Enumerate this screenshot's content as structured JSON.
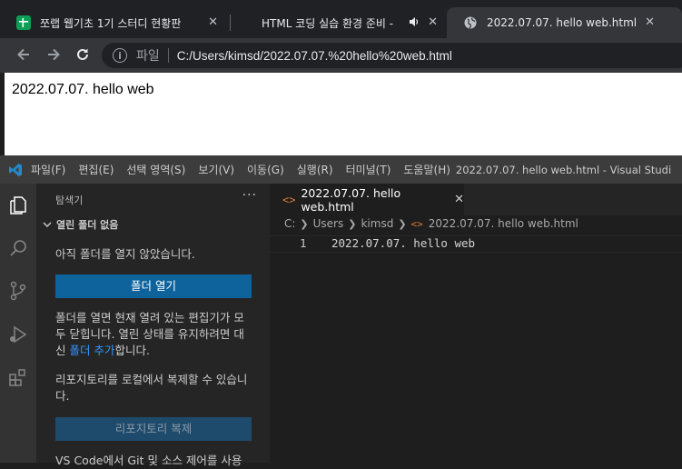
{
  "browser": {
    "tabs": [
      {
        "title": "쪼랩 웹기초 1기 스터디 현황판",
        "icon": "sheets-icon"
      },
      {
        "title": "HTML 코딩 실습 환경 준비 -",
        "icon": "speaker-icon"
      },
      {
        "title": "2022.07.07. hello web.html",
        "icon": "globe-icon"
      }
    ],
    "address": {
      "scheme_label": "파일",
      "url": "C:/Users/kimsd/2022.07.07.%20hello%20web.html"
    },
    "page_text": "2022.07.07. hello web"
  },
  "vscode": {
    "menu": [
      "파일(F)",
      "편집(E)",
      "선택 영역(S)",
      "보기(V)",
      "이동(G)",
      "실행(R)",
      "터미널(T)",
      "도움말(H)"
    ],
    "window_title": "2022.07.07. hello web.html - Visual Studi",
    "sidebar": {
      "header": "탐색기",
      "more": "···",
      "section": "열린 폴더 없음",
      "no_folder_msg": "아직 폴더를 열지 않았습니다.",
      "open_folder_button": "폴더 열기",
      "info_text_a": "폴더를 열면 현재 열려 있는 편집기가 모두 닫힙니다. 열린 상태를 유지하려면 대신 ",
      "info_link": "폴더 추가",
      "info_text_b": "합니다.",
      "clone_msg": "리포지토리를 로컬에서 복제할 수 있습니다.",
      "clone_button": "리포지토리 복제",
      "git_msg": "VS Code에서 Git 및 소스 제어를 사용"
    },
    "editor": {
      "tab_label": "2022.07.07. hello web.html",
      "breadcrumb": [
        "C:",
        "Users",
        "kimsd",
        "2022.07.07. hello web.html"
      ],
      "lines": [
        {
          "number": "1",
          "text": "2022.07.07. hello web"
        }
      ]
    }
  },
  "colors": {
    "accent": "#0e639c",
    "link": "#3794ff",
    "html_icon": "#e37933"
  }
}
